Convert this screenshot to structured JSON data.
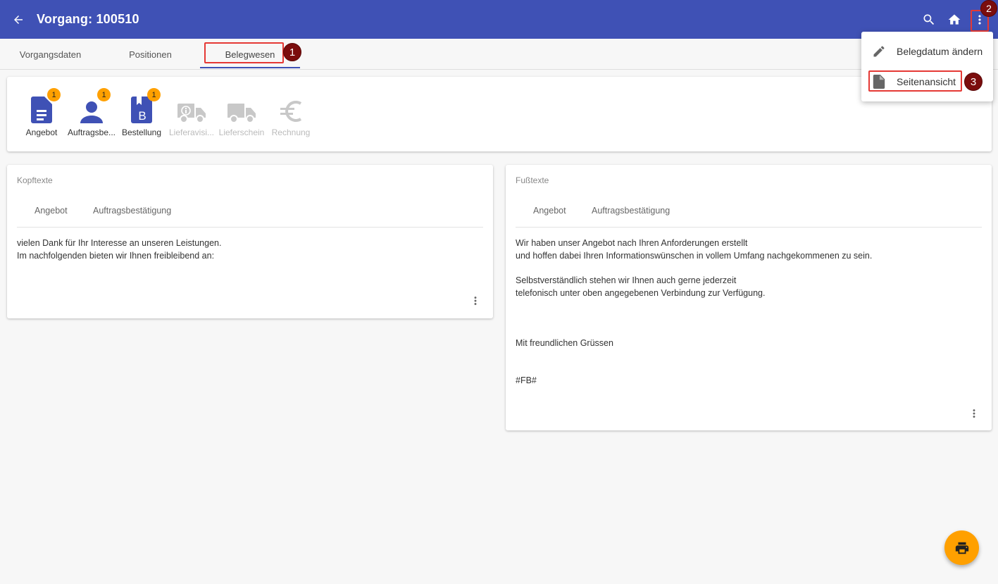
{
  "appbar": {
    "title": "Vorgang: 100510"
  },
  "tabs": [
    {
      "label": "Vorgangsdaten"
    },
    {
      "label": "Positionen"
    },
    {
      "label": "Belegwesen"
    }
  ],
  "annotations": [
    "1",
    "2",
    "3"
  ],
  "documents": [
    {
      "label": "Angebot",
      "badge": "1",
      "icon": "document-icon",
      "enabled": true
    },
    {
      "label": "Auftragsbe...",
      "badge": "1",
      "icon": "person-icon",
      "enabled": true
    },
    {
      "label": "Bestellung",
      "badge": "1",
      "icon": "book-b-icon",
      "enabled": true
    },
    {
      "label": "Lieferavisi...",
      "icon": "truck-info-icon",
      "enabled": false
    },
    {
      "label": "Lieferschein",
      "icon": "truck-icon",
      "enabled": false
    },
    {
      "label": "Rechnung",
      "icon": "euro-icon",
      "enabled": false
    }
  ],
  "kopftexte": {
    "title": "Kopftexte",
    "tabs": [
      "Angebot",
      "Auftragsbestätigung"
    ],
    "lines": [
      "vielen Dank für Ihr Interesse an unseren Leistungen.",
      "Im nachfolgenden bieten wir Ihnen freibleibend an:"
    ]
  },
  "fusstexte": {
    "title": "Fußtexte",
    "tabs": [
      "Angebot",
      "Auftragsbestätigung"
    ],
    "lines": [
      "Wir haben unser Angebot nach Ihren Anforderungen erstellt",
      "und hoffen dabei Ihren Informationswünschen in vollem Umfang nachgekommenen zu sein.",
      "Selbstverständlich stehen wir Ihnen auch gerne jederzeit",
      "telefonisch unter oben angegebenen Verbindung zur Verfügung.",
      "Mit freundlichen Grüssen",
      "#FB#"
    ]
  },
  "menu": {
    "items": [
      {
        "label": "Belegdatum ändern",
        "icon": "pencil-icon"
      },
      {
        "label": "Seitenansicht",
        "icon": "page-icon"
      }
    ]
  },
  "colors": {
    "primary": "#3f51b5",
    "accent": "#ffa000",
    "highlight": "#e53935",
    "marker": "#7b0d0d"
  }
}
